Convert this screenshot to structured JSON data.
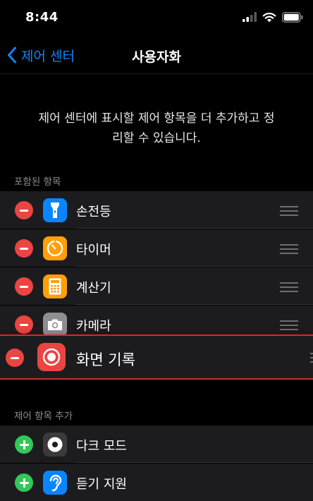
{
  "status_bar": {
    "time": "8:44"
  },
  "nav": {
    "back_label": "제어 센터",
    "title": "사용자화"
  },
  "intro": {
    "line1": "제어 센터에 표시할 제어 항목을 더 추가하고 정",
    "line2": "리할 수 있습니다."
  },
  "included": {
    "header": "포함된 항목",
    "items": [
      {
        "label": "손전등",
        "icon": "flashlight-icon",
        "color": "#0a84ff"
      },
      {
        "label": "타이머",
        "icon": "timer-icon",
        "color": "#ff9f0a"
      },
      {
        "label": "계산기",
        "icon": "calculator-icon",
        "color": "#ff9f0a"
      },
      {
        "label": "카메라",
        "icon": "camera-icon",
        "color": "#8e8e93"
      }
    ],
    "dragging": {
      "label": "화면 기록",
      "icon": "screen-record-icon",
      "color": "#eb4542"
    }
  },
  "more": {
    "header": "제어 항목 추가",
    "items": [
      {
        "label": "다크 모드",
        "icon": "dark-mode-icon",
        "color": "#3a3a3c"
      },
      {
        "label": "듣기 지원",
        "icon": "hearing-icon",
        "color": "#0a84ff"
      }
    ]
  },
  "colors": {
    "accent": "#0a84ff",
    "remove": "#eb4542",
    "add": "#33c759",
    "drag_border": "#d32a2a"
  }
}
